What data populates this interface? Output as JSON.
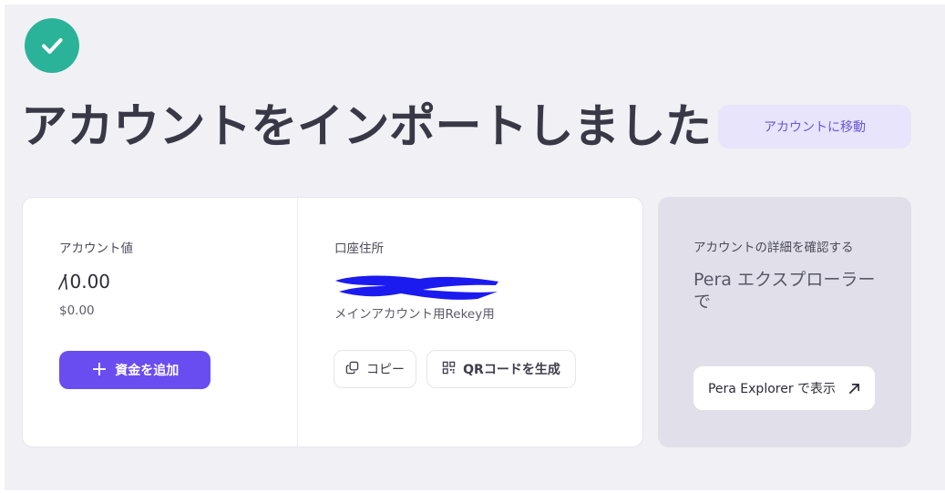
{
  "header": {
    "title": "アカウントをインポートしました",
    "go_to_account_label": "アカウントに移動"
  },
  "account_card": {
    "value_label": "アカウント値",
    "algo_value": "Å0.00",
    "algo_display": "/\\0.00",
    "usd_value": "$0.00",
    "add_funds_label": "資金を追加"
  },
  "address_card": {
    "label": "口座住所",
    "address_redacted": true,
    "subtitle": "メインアカウント用Rekey用",
    "copy_label": "コピー",
    "qr_label": "QRコードを生成"
  },
  "explorer_card": {
    "label": "アカウントの詳細を確認する",
    "title": "Pera エクスプローラーで",
    "button_label": "Pera Explorer で表示"
  },
  "colors": {
    "success": "#2bb39a",
    "primary": "#6a4df0",
    "secondary_bg": "#e7e4fb",
    "redaction": "#1b1bf0"
  }
}
